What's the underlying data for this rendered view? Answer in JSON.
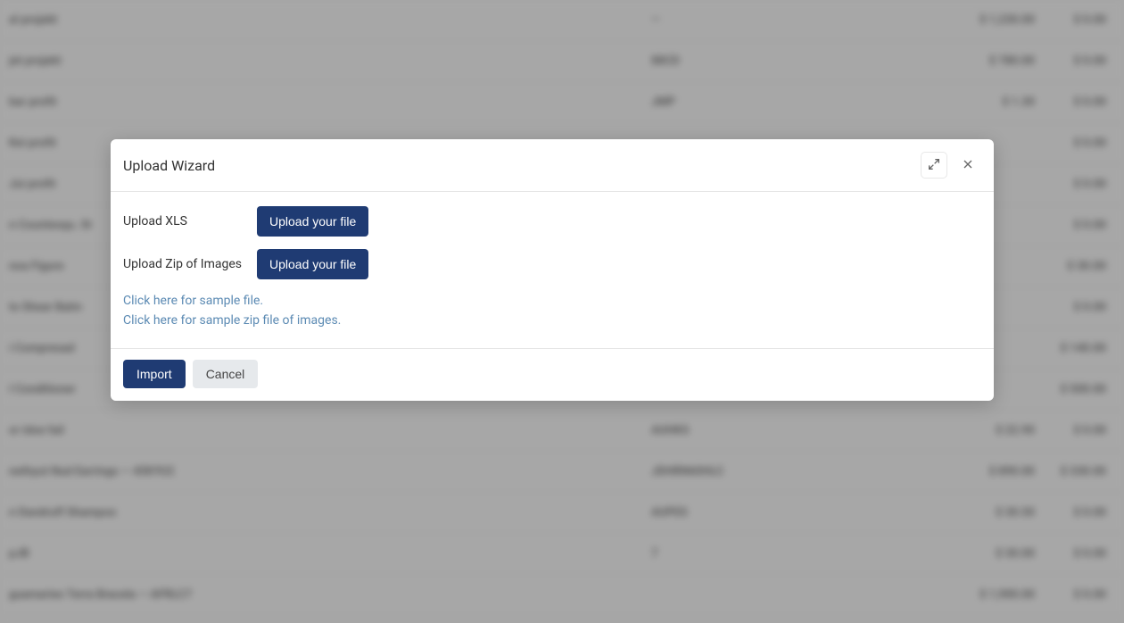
{
  "modal": {
    "title": "Upload Wizard",
    "rows": {
      "xls": {
        "label": "Upload XLS",
        "button": "Upload your file"
      },
      "zip": {
        "label": "Upload Zip of Images",
        "button": "Upload your file"
      }
    },
    "links": {
      "sample_file": "Click here for sample file.",
      "sample_zip": "Click here for sample zip file of images."
    },
    "footer": {
      "import": "Import",
      "cancel": "Cancel"
    }
  },
  "background_rows": [
    {
      "name": "al projekt",
      "code": "—",
      "price": "$ 1,230.00",
      "right": "$ 0.00"
    },
    {
      "name": "jet projekt",
      "code": "88CD",
      "price": "$ 780.00",
      "right": "$ 0.00"
    },
    {
      "name": "bar profit",
      "code": "JMP",
      "price": "$ 1.30",
      "right": "$ 0.00"
    },
    {
      "name": "Kei profit",
      "code": "",
      "price": "",
      "right": "$ 0.00"
    },
    {
      "name": "Jui profit",
      "code": "",
      "price": "",
      "right": "$ 0.00"
    },
    {
      "name": "n Countesqu. St",
      "code": "",
      "price": "",
      "right": "$ 0.00"
    },
    {
      "name": "noa Figure",
      "code": "",
      "price": "",
      "right": "$ 30.00"
    },
    {
      "name": "to Shear Balm",
      "code": "",
      "price": "",
      "right": "$ 0.00"
    },
    {
      "name": "i Compresad",
      "code": "",
      "price": "",
      "right": "$ 140.00"
    },
    {
      "name": "I Conditioner",
      "code": "",
      "price": "",
      "right": "$ 500.00"
    },
    {
      "name": "or idoe fail",
      "code": "AUHKS",
      "price": "$ 22.90",
      "right": "$ 0.00"
    },
    {
      "name": "nethyut Nud Earrings — 45KYU2",
      "code": "JDHRN60HLC",
      "price": "$ 890.00",
      "right": "$ 330.00"
    },
    {
      "name": "n Dandruff Shampoo",
      "code": "AUPES",
      "price": "$ 30.50",
      "right": "$ 0.00"
    },
    {
      "name": "pJB",
      "code": "7",
      "price": "$ 30.00",
      "right": "$ 0.00"
    },
    {
      "name": "guamaries Terra Bracela — AFRLC7",
      "code": "",
      "price": "$ 1,900.00",
      "right": "$ 0.00"
    }
  ]
}
